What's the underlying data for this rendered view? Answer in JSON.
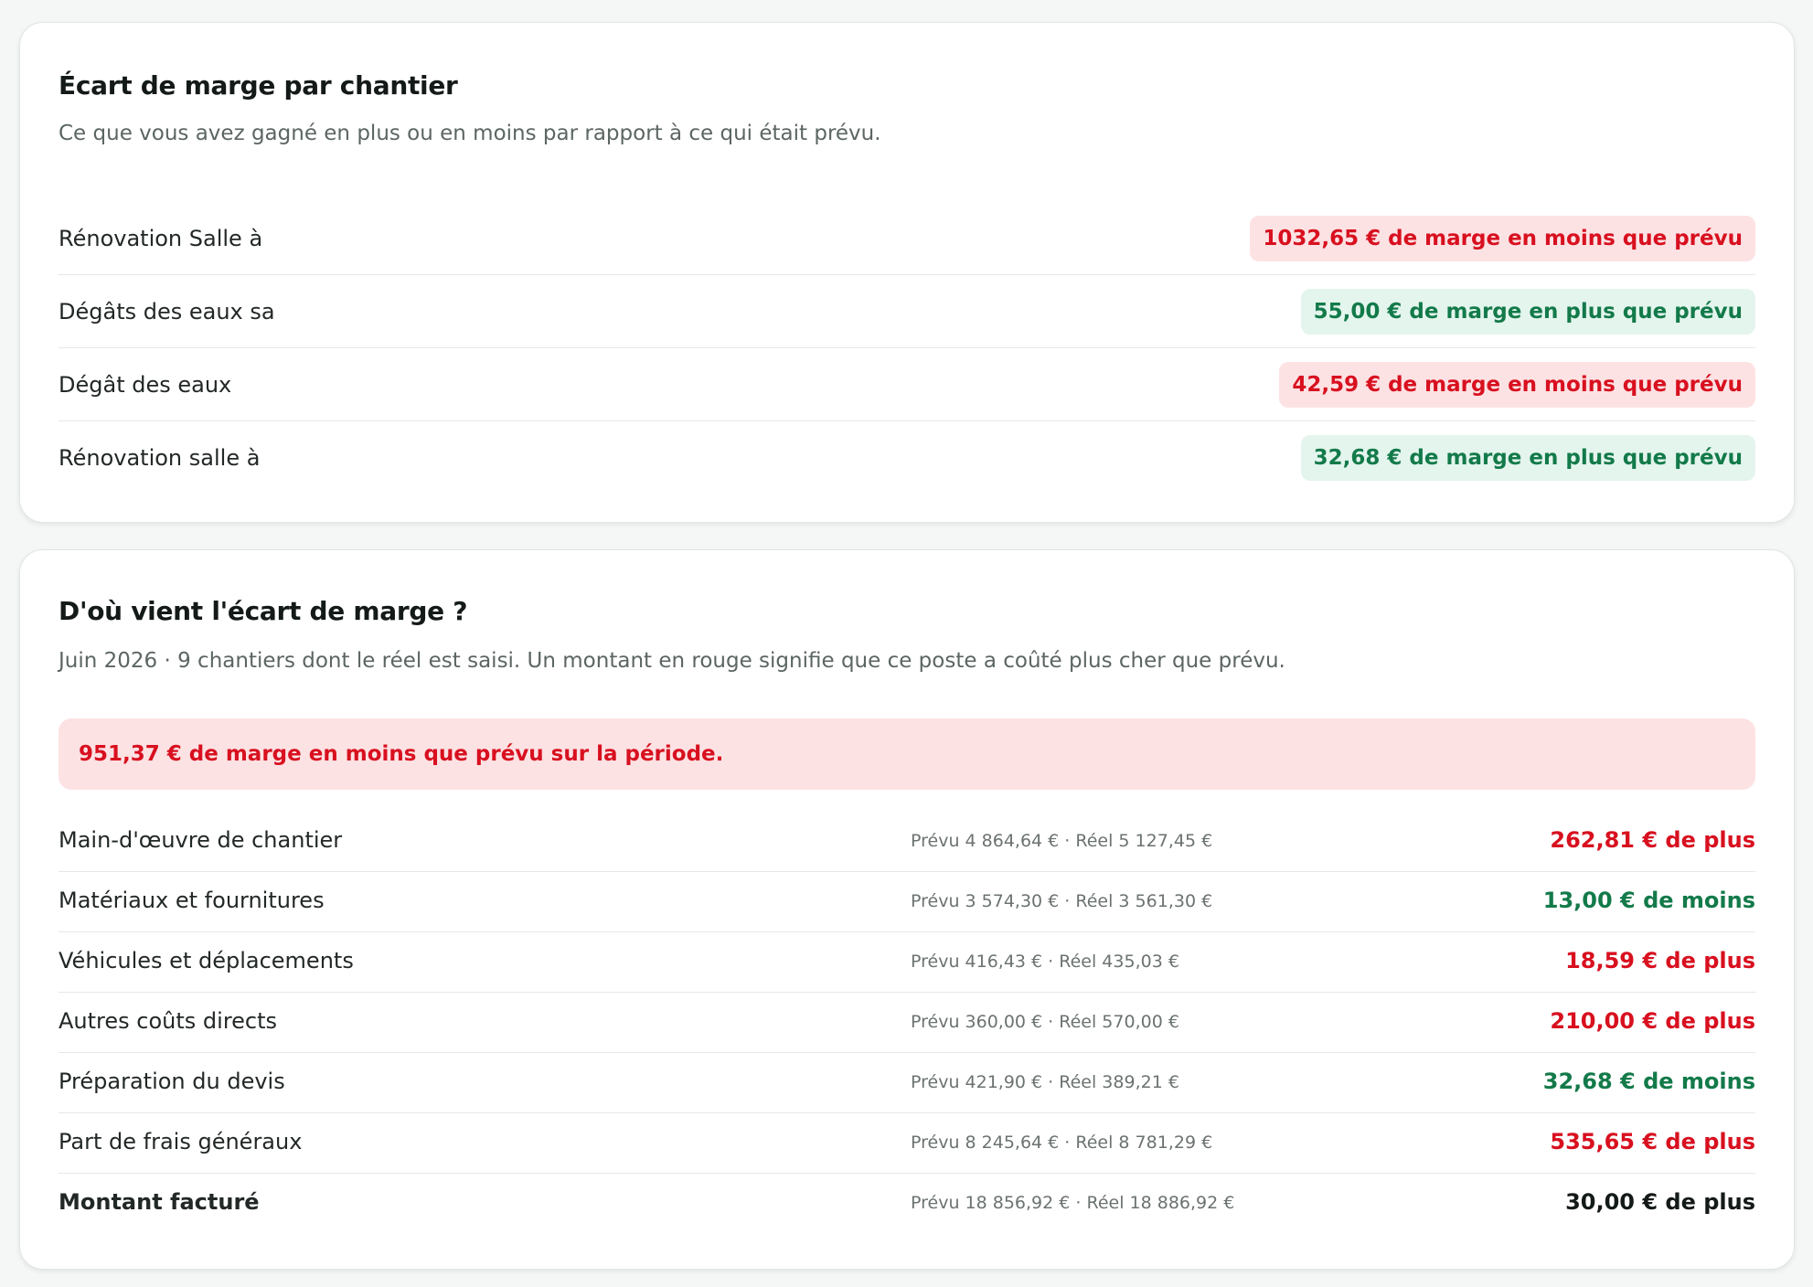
{
  "card1": {
    "title": "Écart de marge par chantier",
    "subtitle": "Ce que vous avez gagné en plus ou en moins par rapport à ce qui était prévu.",
    "rows": [
      {
        "name": "Rénovation Salle à",
        "value": "1032,65 € de marge en moins que prévu",
        "status": "neg"
      },
      {
        "name": "Dégâts des eaux sa",
        "value": "55,00 € de marge en plus que prévu",
        "status": "pos"
      },
      {
        "name": "Dégât des eaux",
        "value": "42,59 € de marge en moins que prévu",
        "status": "neg"
      },
      {
        "name": "Rénovation salle à",
        "value": "32,68 € de marge en plus que prévu",
        "status": "pos"
      }
    ]
  },
  "card2": {
    "title": "D'où vient l'écart de marge ?",
    "subtitle": "Juin 2026 · 9 chantiers dont le réel est saisi. Un montant en rouge signifie que ce poste a coûté plus cher que prévu.",
    "banner": "951,37 € de marge en moins que prévu sur la période.",
    "rows": [
      {
        "name": "Main-d'œuvre de chantier",
        "detail": "Prévu 4 864,64 € · Réel 5 127,45 €",
        "delta": "262,81 € de plus",
        "status": "neg"
      },
      {
        "name": "Matériaux et fournitures",
        "detail": "Prévu 3 574,30 € · Réel 3 561,30 €",
        "delta": "13,00 € de moins",
        "status": "pos"
      },
      {
        "name": "Véhicules et déplacements",
        "detail": "Prévu 416,43 € · Réel 435,03 €",
        "delta": "18,59 € de plus",
        "status": "neg"
      },
      {
        "name": "Autres coûts directs",
        "detail": "Prévu 360,00 € · Réel 570,00 €",
        "delta": "210,00 € de plus",
        "status": "neg"
      },
      {
        "name": "Préparation du devis",
        "detail": "Prévu 421,90 € · Réel 389,21 €",
        "delta": "32,68 € de moins",
        "status": "pos"
      },
      {
        "name": "Part de frais généraux",
        "detail": "Prévu 8 245,64 € · Réel 8 781,29 €",
        "delta": "535,65 € de plus",
        "status": "neg"
      },
      {
        "name": "Montant facturé",
        "detail": "Prévu 18 856,92 € · Réel 18 886,92 €",
        "delta": "30,00 € de plus",
        "status": "neutral"
      }
    ]
  },
  "colors": {
    "negative_text": "#d8101f",
    "negative_bg": "#fde2e4",
    "positive_text": "#137a4a",
    "positive_bg": "#e4f5ed"
  }
}
